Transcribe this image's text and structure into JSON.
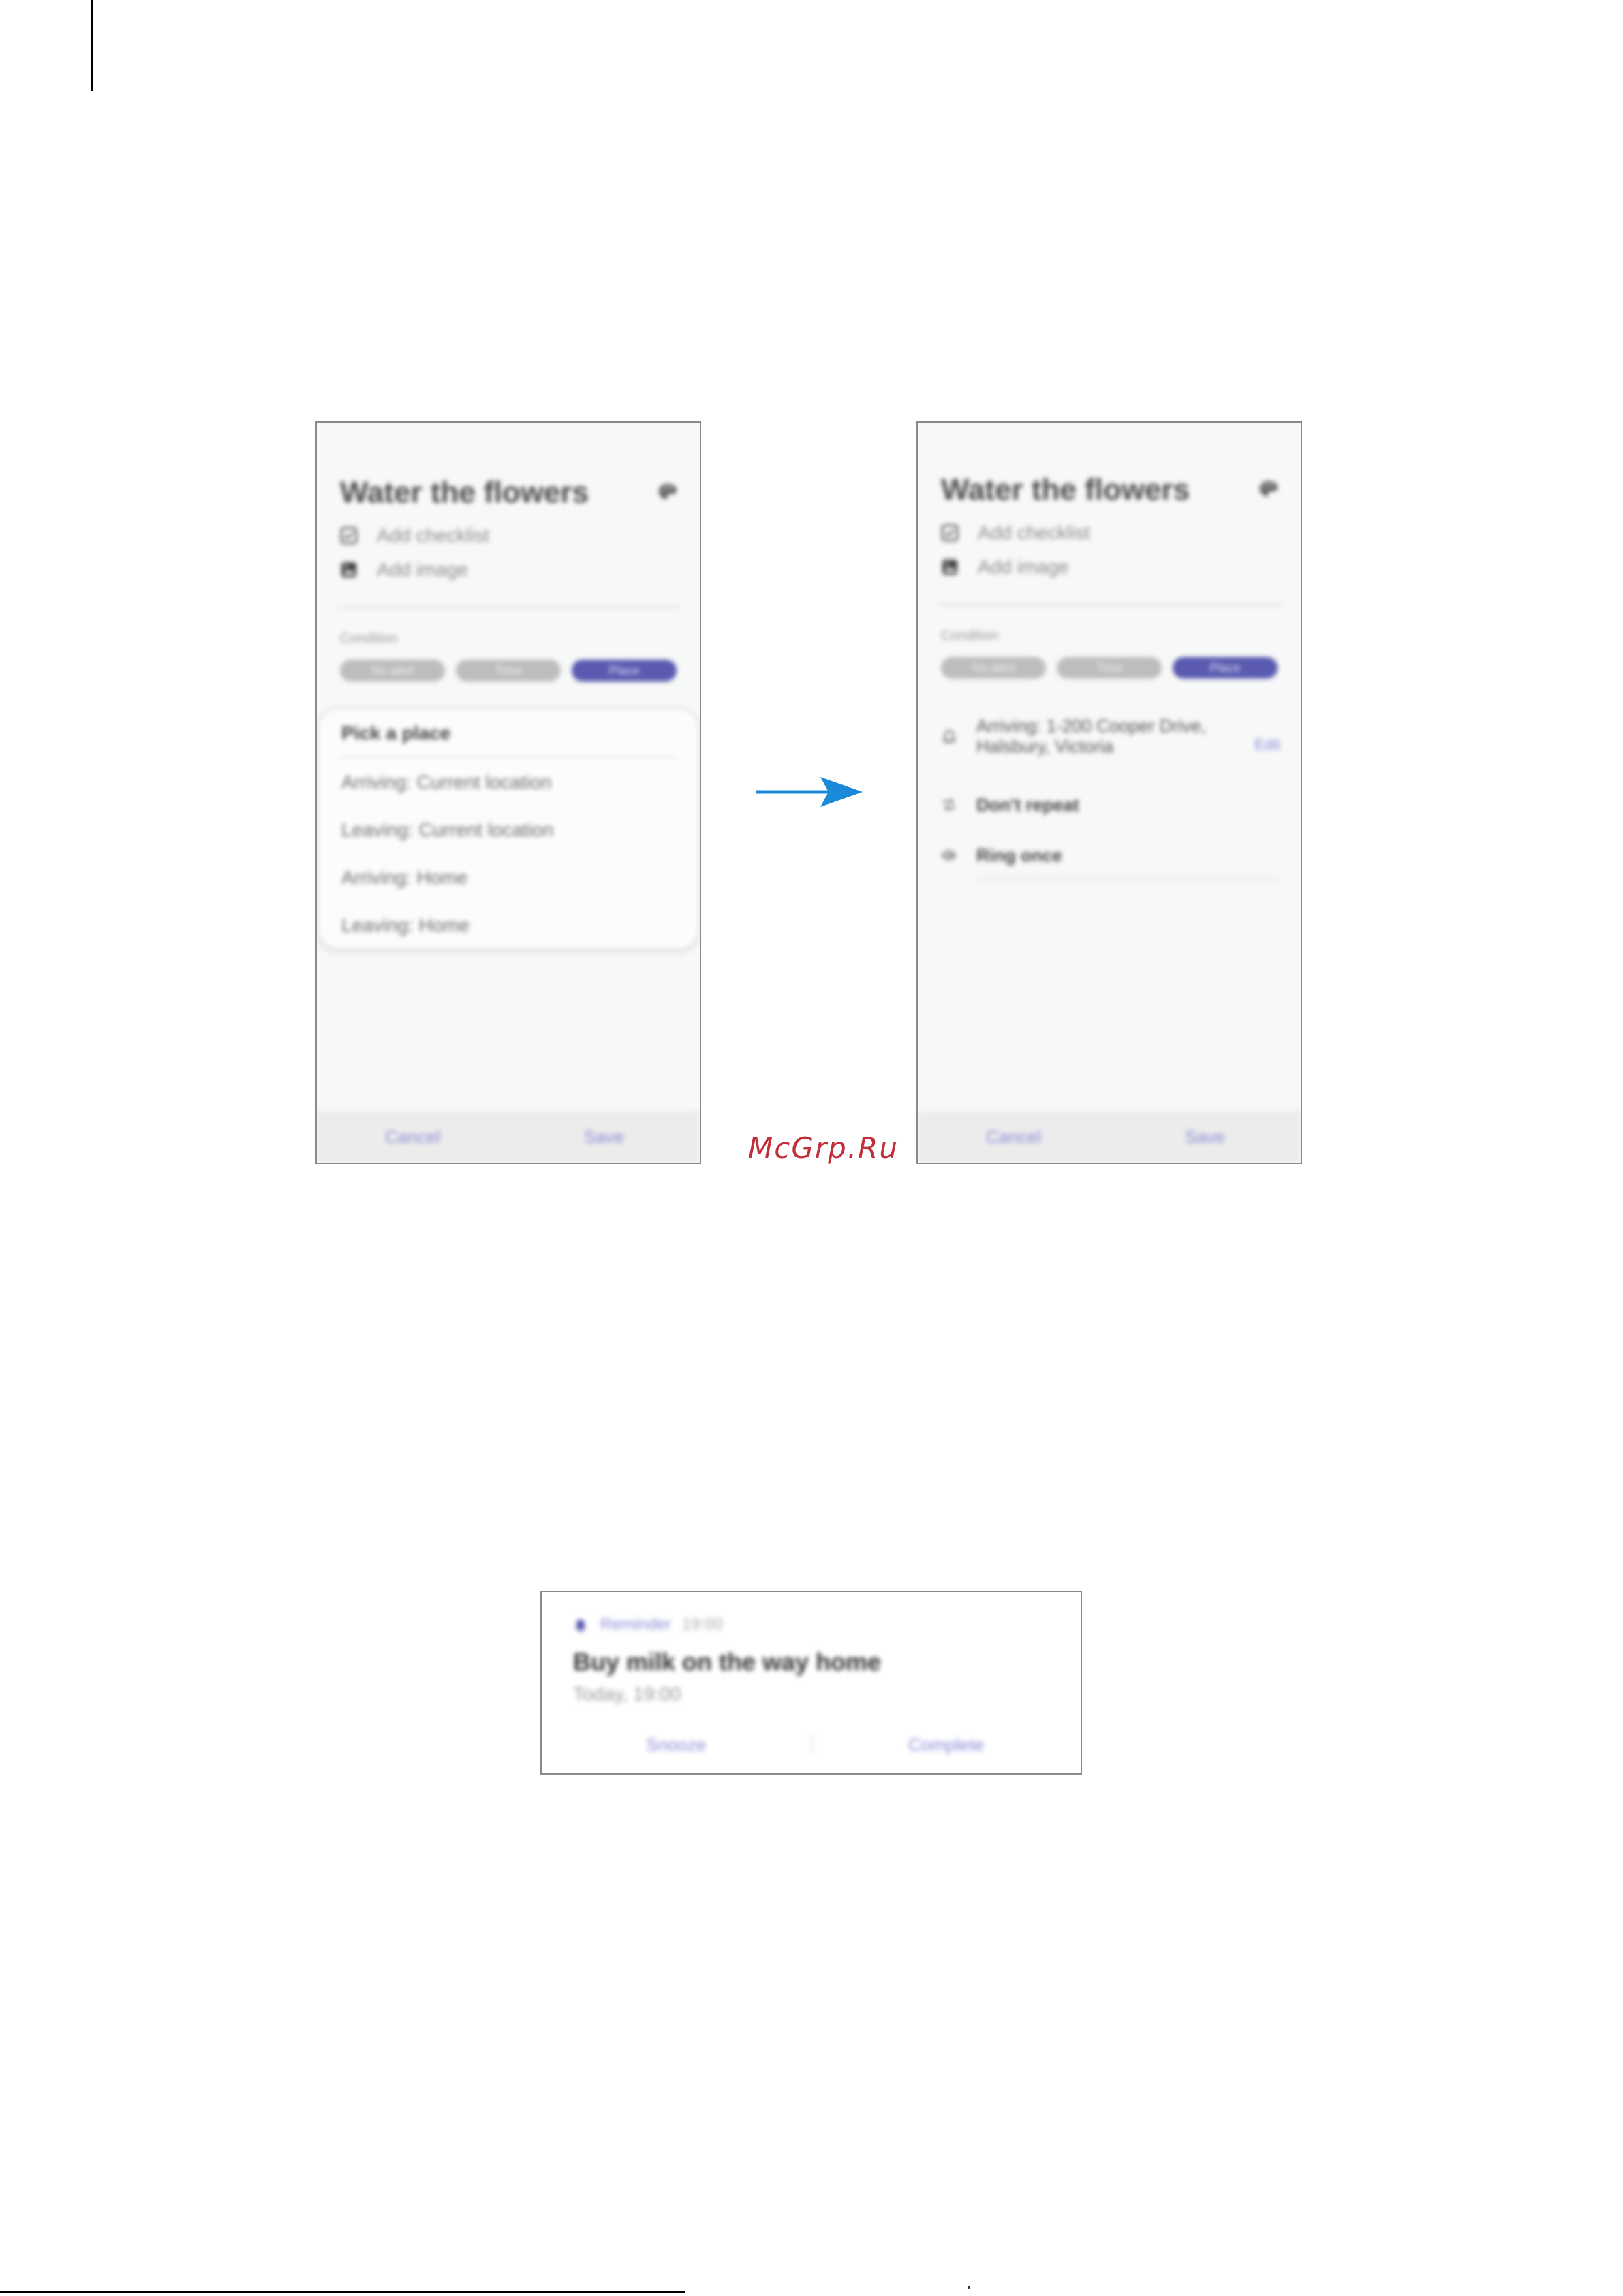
{
  "left_screen": {
    "title": "Water the flowers",
    "options": [
      {
        "icon": "checkbox-icon",
        "label": "Add checklist"
      },
      {
        "icon": "image-icon",
        "label": "Add image"
      }
    ],
    "condition_label": "Condition",
    "conditions": [
      "No alert",
      "Time",
      "Place"
    ],
    "active_condition": "Place",
    "dropdown": {
      "items": [
        "Pick a place",
        "Arriving: Current location",
        "Leaving: Current location",
        "Arriving: Home",
        "Leaving: Home"
      ]
    },
    "footer": {
      "cancel": "Cancel",
      "save": "Save"
    }
  },
  "right_screen": {
    "title": "Water the flowers",
    "options": [
      {
        "icon": "checkbox-icon",
        "label": "Add checklist"
      },
      {
        "icon": "image-icon",
        "label": "Add image"
      }
    ],
    "condition_label": "Condition",
    "conditions": [
      "No alert",
      "Time",
      "Place"
    ],
    "active_condition": "Place",
    "details": {
      "location": "Arriving: 1-200 Cooper Drive, Halsbury, Victoria",
      "edit": "Edit",
      "repeat": "Don't repeat",
      "sound": "Ring once"
    },
    "footer": {
      "cancel": "Cancel",
      "save": "Save"
    }
  },
  "watermark": "McGrp.Ru",
  "notification": {
    "app": "Reminder",
    "time": "19:00",
    "title": "Buy milk on the way home",
    "subtitle": "Today, 19:00",
    "actions": [
      "Snooze",
      "Complete"
    ]
  },
  "colors": {
    "accent": "#5a5ab0",
    "arrow": "#1a8ad8",
    "watermark": "#c0303a"
  }
}
